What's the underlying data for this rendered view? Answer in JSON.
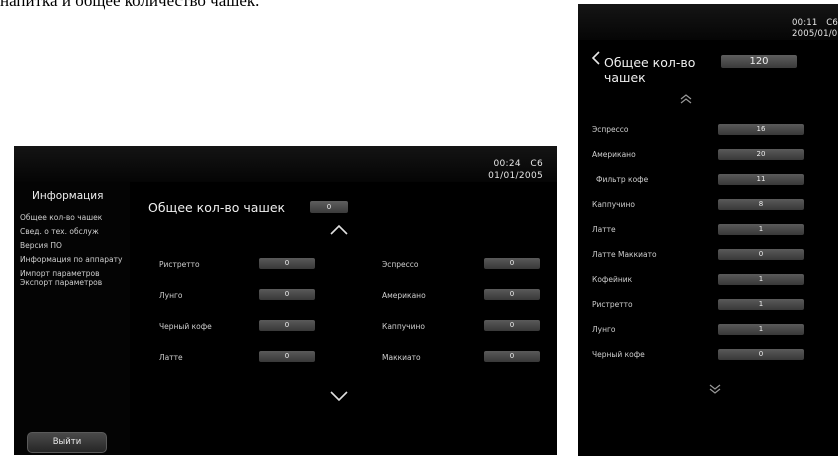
{
  "document": {
    "fragment_text": "напитка и общее количество чашек."
  },
  "left_screen": {
    "clock": {
      "time": "00:24",
      "code": "C6",
      "date": "01/01/2005"
    },
    "sidebar": {
      "title": "Информация",
      "items": [
        {
          "label": "Общее кол-во чашек"
        },
        {
          "label": "Свед. о тех. обслуж"
        },
        {
          "label": "Версия ПО"
        },
        {
          "label": "Информация по аппарату"
        },
        {
          "label": "Импорт параметров"
        },
        {
          "label": "Экспорт параметров"
        }
      ],
      "exit_label": "Выйти"
    },
    "total": {
      "label": "Общее кол-во чашек",
      "value": "0"
    },
    "rows_left": [
      {
        "label": "Ристретто",
        "value": "0"
      },
      {
        "label": "Лунго",
        "value": "0"
      },
      {
        "label": "Черный кофе",
        "value": "0"
      },
      {
        "label": "Латте",
        "value": "0"
      }
    ],
    "rows_right": [
      {
        "label": "Эспрессо",
        "value": "0"
      },
      {
        "label": "Американо",
        "value": "0"
      },
      {
        "label": "Каппучино",
        "value": "0"
      },
      {
        "label": "Маккиато",
        "value": "0"
      }
    ],
    "icons": {
      "up": "chevron-up-icon",
      "down": "chevron-down-icon"
    }
  },
  "right_screen": {
    "clock": {
      "time": "00:11",
      "code": "C6",
      "date": "2005/01/0"
    },
    "title": "Общее кол-во чашек",
    "total_value": "120",
    "rows": [
      {
        "label": "Эспрессо",
        "value": "16"
      },
      {
        "label": "Американо",
        "value": "20"
      },
      {
        "label": "Фильтр кофе",
        "value": "11"
      },
      {
        "label": "Каппучино",
        "value": "8"
      },
      {
        "label": "Латте",
        "value": "1"
      },
      {
        "label": "Латте Маккиато",
        "value": "0"
      },
      {
        "label": "Кофейник",
        "value": "1"
      },
      {
        "label": "Ристретто",
        "value": "1"
      },
      {
        "label": "Лунго",
        "value": "1"
      },
      {
        "label": "Черный кофе",
        "value": "0"
      }
    ],
    "icons": {
      "back": "chevron-left-icon",
      "up": "double-chevron-up-icon",
      "down": "double-chevron-down-icon"
    }
  }
}
